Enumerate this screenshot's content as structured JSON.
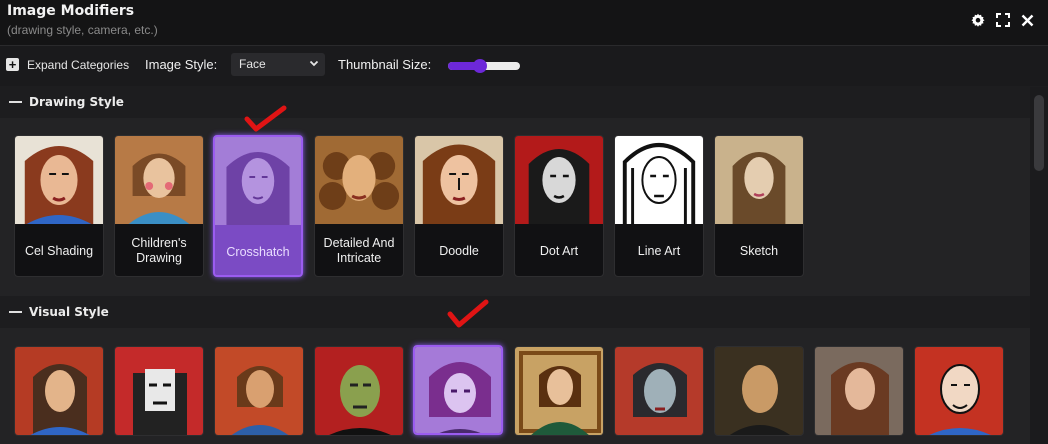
{
  "header": {
    "title": "Image Modifiers",
    "subtitle": "(drawing style, camera, etc.)",
    "icons": [
      "gear-icon",
      "fullscreen-icon",
      "close-icon"
    ]
  },
  "toolbar": {
    "expand_label": "Expand Categories",
    "image_style_label": "Image Style:",
    "image_style_value": "Face",
    "thumbnail_size_label": "Thumbnail Size:",
    "thumbnail_size_fraction": 0.45
  },
  "sections": [
    {
      "title": "Drawing Style",
      "items": [
        {
          "label": "Cel Shading",
          "selected": false
        },
        {
          "label": "Children's Drawing",
          "selected": false
        },
        {
          "label": "Crosshatch",
          "selected": true
        },
        {
          "label": "Detailed And Intricate",
          "selected": false
        },
        {
          "label": "Doodle",
          "selected": false
        },
        {
          "label": "Dot Art",
          "selected": false
        },
        {
          "label": "Line Art",
          "selected": false
        },
        {
          "label": "Sketch",
          "selected": false
        }
      ]
    },
    {
      "title": "Visual Style",
      "selected_index": 4,
      "item_count": 10
    }
  ],
  "colors": {
    "accent": "#8b5cf6",
    "check_mark": "#e01414",
    "background": "#1d1d1f"
  }
}
